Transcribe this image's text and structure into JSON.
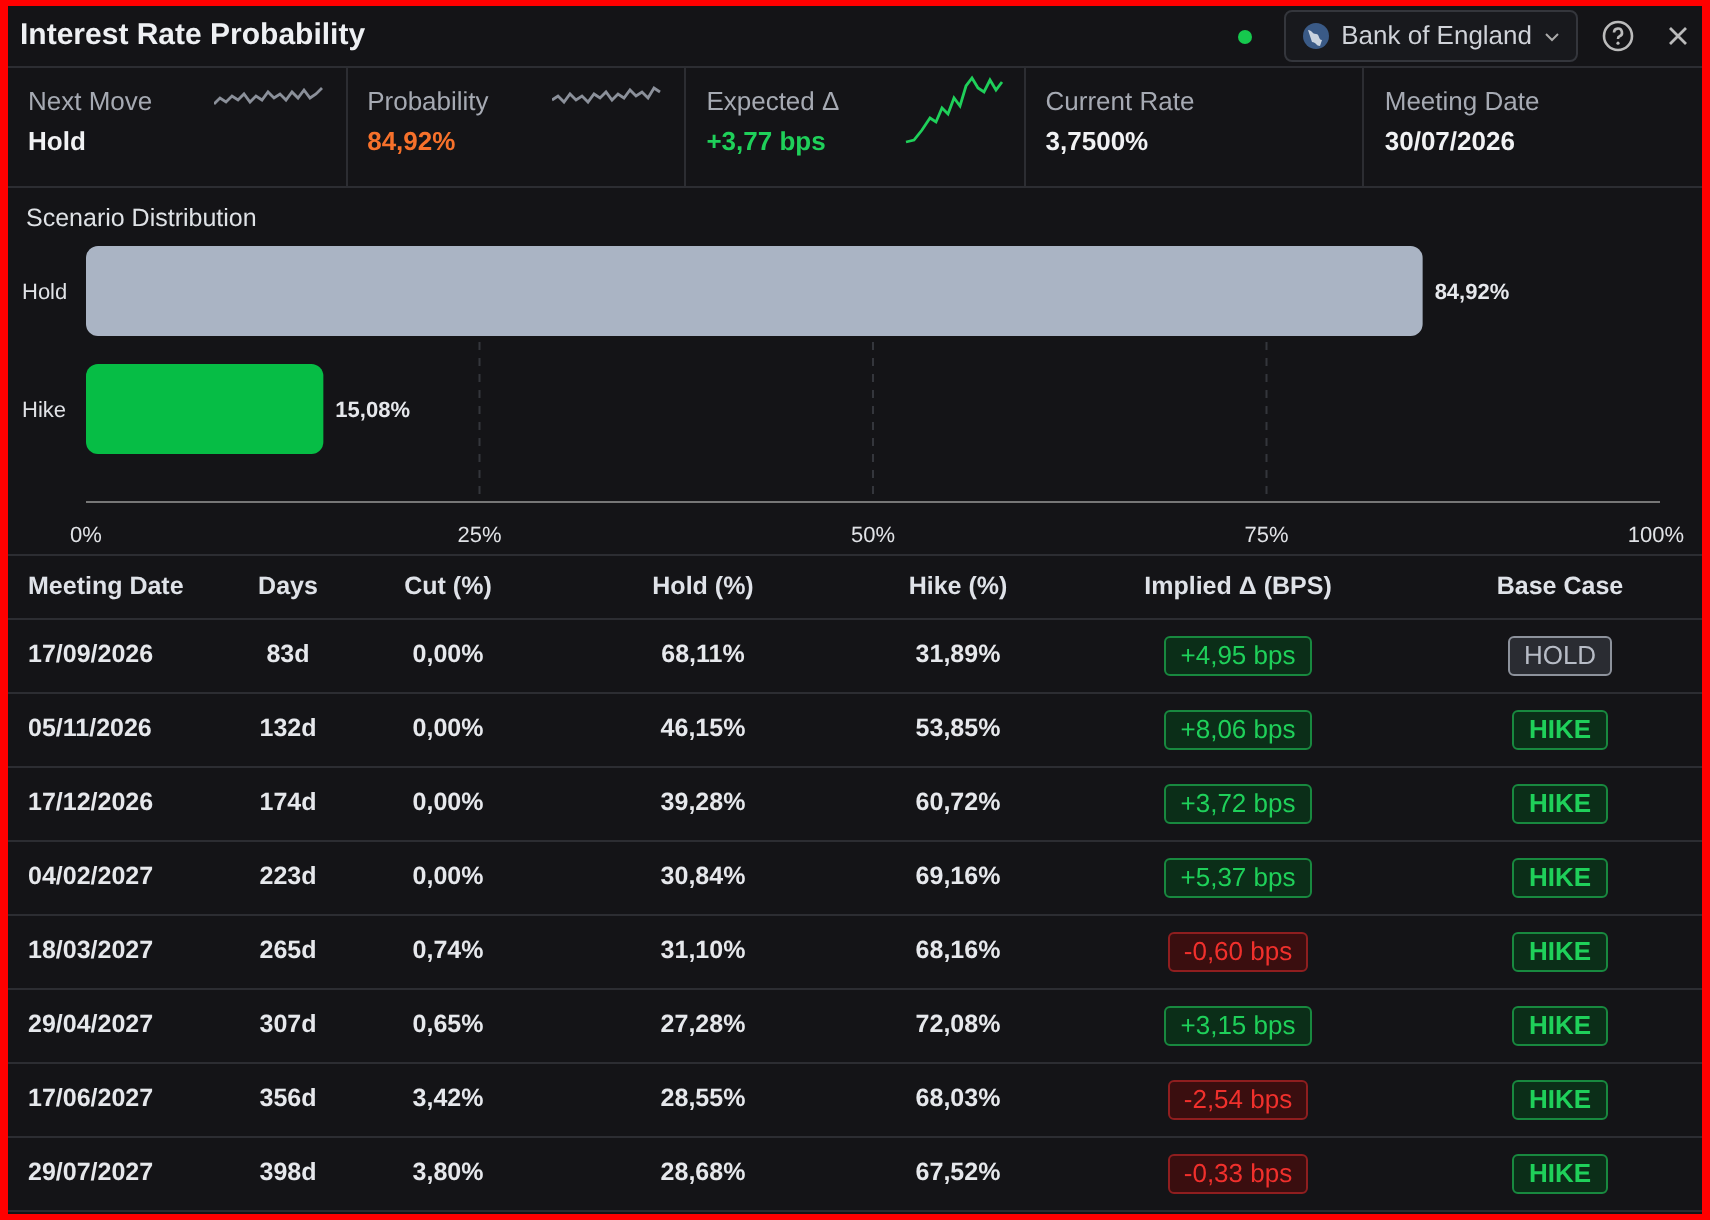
{
  "window": {
    "title": "Interest Rate Probability",
    "status_online": true
  },
  "bank_selector": {
    "label": "Bank of England"
  },
  "stats": [
    {
      "label": "Next Move",
      "value": "Hold",
      "kind": "plain",
      "sparkline": true
    },
    {
      "label": "Probability",
      "value": "84,92%",
      "kind": "warning",
      "sparkline": true
    },
    {
      "label": "Expected Δ",
      "value": "+3,77 bps",
      "kind": "positive",
      "sparkline": true
    },
    {
      "label": "Current Rate",
      "value": "3,7500%",
      "kind": "plain",
      "sparkline": false
    },
    {
      "label": "Meeting Date",
      "value": "30/07/2026",
      "kind": "plain",
      "sparkline": false
    }
  ],
  "scenario": {
    "title": "Scenario Distribution",
    "chart_data": {
      "type": "bar",
      "orientation": "horizontal",
      "categories": [
        "Hold",
        "Hike"
      ],
      "grid": true,
      "series": [
        {
          "color": "#aab4c4",
          "values": [
            84.92,
            null
          ]
        },
        {
          "color": "#06bd45",
          "values": [
            null,
            15.08
          ]
        }
      ],
      "xlim": [
        0,
        100
      ],
      "xticks": [
        {
          "value": 0,
          "label": "0%"
        },
        {
          "value": 25,
          "label": "25%"
        },
        {
          "value": 50,
          "label": "50%"
        },
        {
          "value": 75,
          "label": "75%"
        },
        {
          "value": 100,
          "label": "100%"
        }
      ],
      "value_labels": [
        "84,92%",
        "15,08%"
      ]
    }
  },
  "table": {
    "columns": [
      "Meeting Date",
      "Days",
      "Cut (%)",
      "Hold (%)",
      "Hike (%)",
      "Implied Δ (BPS)",
      "Base Case"
    ],
    "rows": [
      {
        "date": "17/09/2026",
        "days": "83d",
        "cut": "0,00%",
        "hold": "68,11%",
        "hike": "31,89%",
        "implied": {
          "text": "+4,95 bps",
          "kind": "up"
        },
        "base": {
          "text": "HOLD",
          "kind": "hold"
        }
      },
      {
        "date": "05/11/2026",
        "days": "132d",
        "cut": "0,00%",
        "hold": "46,15%",
        "hike": "53,85%",
        "implied": {
          "text": "+8,06 bps",
          "kind": "up"
        },
        "base": {
          "text": "HIKE",
          "kind": "hike"
        }
      },
      {
        "date": "17/12/2026",
        "days": "174d",
        "cut": "0,00%",
        "hold": "39,28%",
        "hike": "60,72%",
        "implied": {
          "text": "+3,72 bps",
          "kind": "up"
        },
        "base": {
          "text": "HIKE",
          "kind": "hike"
        }
      },
      {
        "date": "04/02/2027",
        "days": "223d",
        "cut": "0,00%",
        "hold": "30,84%",
        "hike": "69,16%",
        "implied": {
          "text": "+5,37 bps",
          "kind": "up"
        },
        "base": {
          "text": "HIKE",
          "kind": "hike"
        }
      },
      {
        "date": "18/03/2027",
        "days": "265d",
        "cut": "0,74%",
        "hold": "31,10%",
        "hike": "68,16%",
        "implied": {
          "text": "-0,60 bps",
          "kind": "down"
        },
        "base": {
          "text": "HIKE",
          "kind": "hike"
        }
      },
      {
        "date": "29/04/2027",
        "days": "307d",
        "cut": "0,65%",
        "hold": "27,28%",
        "hike": "72,08%",
        "implied": {
          "text": "+3,15 bps",
          "kind": "up"
        },
        "base": {
          "text": "HIKE",
          "kind": "hike"
        }
      },
      {
        "date": "17/06/2027",
        "days": "356d",
        "cut": "3,42%",
        "hold": "28,55%",
        "hike": "68,03%",
        "implied": {
          "text": "-2,54 bps",
          "kind": "down"
        },
        "base": {
          "text": "HIKE",
          "kind": "hike"
        }
      },
      {
        "date": "29/07/2027",
        "days": "398d",
        "cut": "3,80%",
        "hold": "28,68%",
        "hike": "67,52%",
        "implied": {
          "text": "-0,33 bps",
          "kind": "down"
        },
        "base": {
          "text": "HIKE",
          "kind": "hike"
        }
      }
    ]
  }
}
